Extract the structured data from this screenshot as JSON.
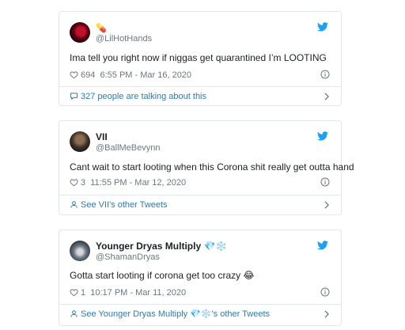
{
  "tweets": [
    {
      "display_name": "",
      "name_badge": "💊",
      "handle": "@LilHotHands",
      "text": "Ima tell you right now if niggas get quarantined I’m LOOTING",
      "likes": "694",
      "timestamp": "6:55 PM - Mar 16, 2020",
      "footer": "327 people are talking about this",
      "footer_icon": "comment-icon"
    },
    {
      "display_name": "VII",
      "handle": "@BallMeBevynn",
      "text": "Cant wait to start looting when this Corona shit really get outta hand",
      "likes": "3",
      "timestamp": "11:55 PM - Mar 12, 2020",
      "footer": "See VII's other Tweets",
      "footer_icon": "person-icon"
    },
    {
      "display_name": "Younger Dryas Multiply 💎❄️",
      "handle": "@ShamanDryas",
      "text": "Gotta start looting if corona get too crazy 😂",
      "likes": "1",
      "timestamp": "10:17 PM - Mar 11, 2020",
      "footer": "See Younger Dryas Multiply 💎❄️'s other Tweets",
      "footer_icon": "person-icon"
    }
  ],
  "colors": {
    "border": "#e1e8ed",
    "link_blue": "#2b7bb9",
    "twitter_blue": "#1da1f2",
    "meta_gray": "#697882",
    "text": "#1c2022"
  }
}
